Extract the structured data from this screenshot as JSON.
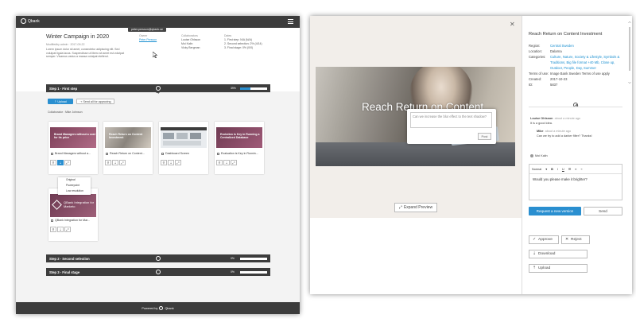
{
  "left": {
    "brand": "Qbank",
    "tooltip": "peter.persson@qbank.se",
    "title": "Winter Campaign in 2020",
    "meta": "Modifiedby admin · 2017-09-22",
    "description": "Lorem ipsum dolor sit amet, consectetur adipiscing elit. Sed volutpat ligula lacus. Suspendisse ut libero sit amet est volutpat semper. Vivamus varius a massa volutpat eleifend.",
    "owner": {
      "heading": "Owner",
      "link": "Peter Persson"
    },
    "collaborators": {
      "heading": "Collaborators",
      "names": [
        "Louise Ohlsson",
        "Moi Kalin",
        "Vicky Bergman"
      ]
    },
    "dates": {
      "heading": "Dates",
      "items": [
        "1. First step: N/A (N/A)",
        "2. Second selection: 2% (4/14)",
        "3. Final stage: 0% (0/0)"
      ]
    },
    "step1": {
      "label": "Step 1 - First step",
      "percent": "39%",
      "fraction": 0.39
    },
    "upload_label": "Upload",
    "send_label": "Send all for approving",
    "collaborator_line": "Collaborator : Mike Johnson",
    "cards": [
      {
        "thumb_text": "Brand Managers without a cost for its price",
        "name": "Brand Managers without a..."
      },
      {
        "thumb_text": "Reach Return on Content Investment",
        "name": "Reach Return on Content..."
      },
      {
        "thumb_text": "",
        "name": "Dashboard Screen"
      },
      {
        "thumb_text": "Evolution is Key in Running a Centralized Database",
        "name": "Evaluation is Key in Runnin..."
      },
      {
        "thumb_text": "QBank Integration for Marketo",
        "name": "QBank Integration for Mar..."
      }
    ],
    "dropdown": [
      "Original",
      "Powerpoint",
      "Low resolution"
    ],
    "step2": {
      "label": "Step 2 - Second selection",
      "percent": "0%",
      "fraction": 0
    },
    "step3": {
      "label": "Step 3 - Final stage",
      "percent": "0%",
      "fraction": 0
    },
    "footer_text": "Powered by",
    "footer_brand": "Qbank"
  },
  "right": {
    "headline": "Reach Return on Content",
    "comment_placeholder": "Can we increase the blur effect to the text shadow?",
    "post_label": "Post",
    "expand_label": "Expand Preview",
    "panel_title": "Reach Return on Content Investment",
    "meta": [
      {
        "k": "Region:",
        "v": "Central Sweden",
        "link": true
      },
      {
        "k": "Location:",
        "v": "Dalarna",
        "link": false
      },
      {
        "k": "Categories:",
        "v": "Culture, Nature, Society & Lifestyle, Symbols & Traditions, Big file format +40 Mb, Close up, Outdoor, People, Day, Summer",
        "link": true
      },
      {
        "k": "Terms of use:",
        "v": "Image Bank Sweden Terms of use apply",
        "link": false
      },
      {
        "k": "Created:",
        "v": "2017-10-23",
        "link": false
      },
      {
        "k": "ID:",
        "v": "5837",
        "link": false
      }
    ],
    "comments": [
      {
        "author": "Louise Ohlsson",
        "time": "about a minute ago",
        "text": "It is a good idea."
      },
      {
        "author": "Mike",
        "time": "about a minute ago",
        "text": "Can we try to add a darker filter? Thanks!"
      }
    ],
    "reply_author": "Moi Kalin",
    "editor_format": "Normal",
    "editor_text": "Would you please make it brighter?",
    "request_label": "Request a new version",
    "send_label": "Send",
    "approve_label": "Approve",
    "reject_label": "Reject",
    "download_label": "Download",
    "upload_label": "Upload"
  },
  "colors": {
    "accent": "#2a8fd0",
    "dark_bar": "#3c3c3c"
  }
}
